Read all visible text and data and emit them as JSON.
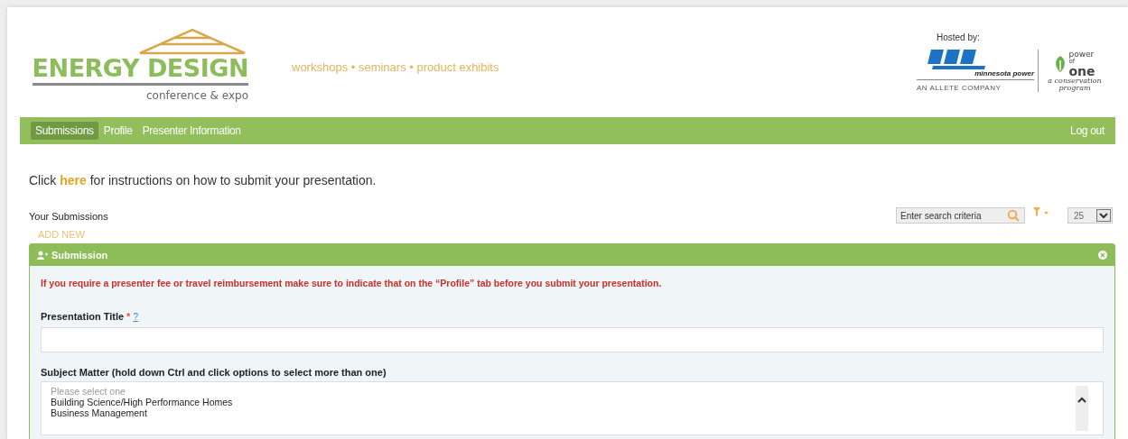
{
  "header": {
    "logo_title": "ENERGY DESIGN",
    "logo_subtitle": "conference & expo",
    "tagline": "workshops • seminars • product exhibits",
    "hosted_by": "Hosted by:",
    "host_logo": {
      "name": "minnesota power",
      "company": "AN ALLETE COMPANY"
    },
    "partner_logo": {
      "top": "power",
      "middle": "of",
      "bottom": "one",
      "slogan": "a conservation program"
    }
  },
  "nav": {
    "tabs": [
      {
        "label": "Submissions",
        "selected": true
      },
      {
        "label": "Profile",
        "selected": false
      },
      {
        "label": "Presenter Information",
        "selected": false
      }
    ],
    "logout": "Log out"
  },
  "instructions": {
    "before": "Click",
    "link": "here",
    "after": "for instructions on how to submit your presentation."
  },
  "submissions": {
    "title": "Your Submissions",
    "add_new": "ADD NEW",
    "search": {
      "placeholder": "Enter search criteria"
    },
    "page_size": "25"
  },
  "panel": {
    "title": "Submission",
    "notice": "If you require a presenter fee or travel reimbursement make sure to indicate that on the “Profile” tab before you submit your presentation.",
    "fields": [
      {
        "kind": "text",
        "label": "Presentation Title",
        "required_mark": "*",
        "help": "?"
      },
      {
        "kind": "multiselect",
        "label": "Subject Matter (hold down Ctrl and click options to select more than one)",
        "placeholder": "Please select one",
        "options": [
          "Building Science/High Performance Homes",
          "Business Management"
        ]
      }
    ]
  }
}
